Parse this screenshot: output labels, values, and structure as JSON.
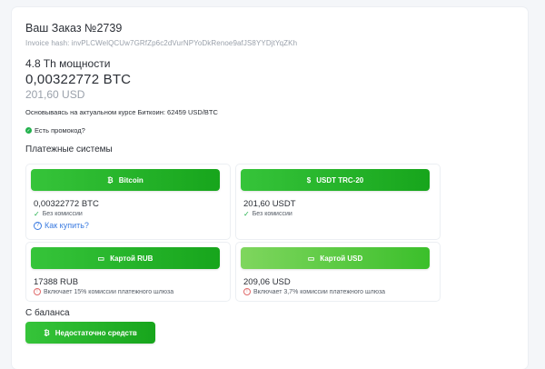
{
  "order": {
    "title": "Ваш Заказ №2739",
    "hash": "Invoice hash: invPLCWelQCUw7GRfZp6c2dVurNPYoDkRenoe9afJS8YYDjtYqZKh",
    "power": "4.8 Th мощности",
    "btc_amount": "0,00322772 BTC",
    "usd_amount": "201,60 USD",
    "rate_note": "Основываясь на актуальном курсе Биткоин: 62459 USD/BTC",
    "promo": "Есть промокод?"
  },
  "payment": {
    "section_title": "Платежные системы",
    "methods": [
      {
        "label": "Bitcoin",
        "icon": "bitcoin-icon",
        "glyph": "₿",
        "amount": "0,00322772 BTC",
        "note": "Без комиссии",
        "help": "Как купить?"
      },
      {
        "label": "USDT TRC-20",
        "icon": "dollar-icon",
        "glyph": "$",
        "amount": "201,60 USDT",
        "note": "Без комиссии"
      },
      {
        "label": "Картой RUB",
        "icon": "card-icon",
        "glyph": "▭",
        "amount": "17388 RUB",
        "note": "Включает 15% комиссии платежного шлюза"
      },
      {
        "label": "Картой USD",
        "icon": "card-icon",
        "glyph": "▭",
        "amount": "209,06 USD",
        "note": "Включает 3,7% комиссии платежного шлюза"
      }
    ]
  },
  "balance": {
    "label": "С баланса",
    "button": "Недостаточно средств",
    "glyph": "₿"
  },
  "colors": {
    "accent_green": "#22b14c",
    "link_blue": "#3b7be0",
    "warning_red": "#e06a6a"
  }
}
